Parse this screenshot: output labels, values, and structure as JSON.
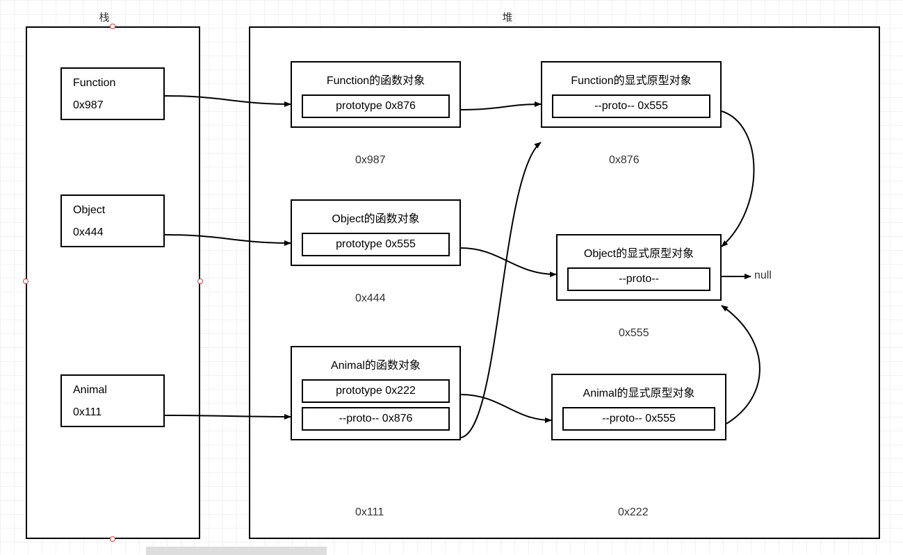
{
  "titles": {
    "stack": "栈",
    "heap": "堆"
  },
  "stack": {
    "items": [
      {
        "name": "Function",
        "addr": "0x987"
      },
      {
        "name": "Object",
        "addr": "0x444"
      },
      {
        "name": "Animal",
        "addr": "0x111"
      }
    ]
  },
  "heap": {
    "function_obj": {
      "title": "Function的函数对象",
      "prototype": "prototype 0x876",
      "addr": "0x987"
    },
    "object_obj": {
      "title": "Object的函数对象",
      "prototype": "prototype 0x555",
      "addr": "0x444"
    },
    "animal_obj": {
      "title": "Animal的函数对象",
      "prototype": "prototype 0x222",
      "proto": "--proto--  0x876",
      "addr": "0x111"
    },
    "function_proto": {
      "title": "Function的显式原型对象",
      "proto": "--proto-- 0x555",
      "addr": "0x876"
    },
    "object_proto": {
      "title": "Object的显式原型对象",
      "proto": "--proto--",
      "addr": "0x555"
    },
    "animal_proto": {
      "title": "Animal的显式原型对象",
      "proto": "--proto-- 0x555",
      "addr": "0x222"
    },
    "null_label": "null"
  }
}
